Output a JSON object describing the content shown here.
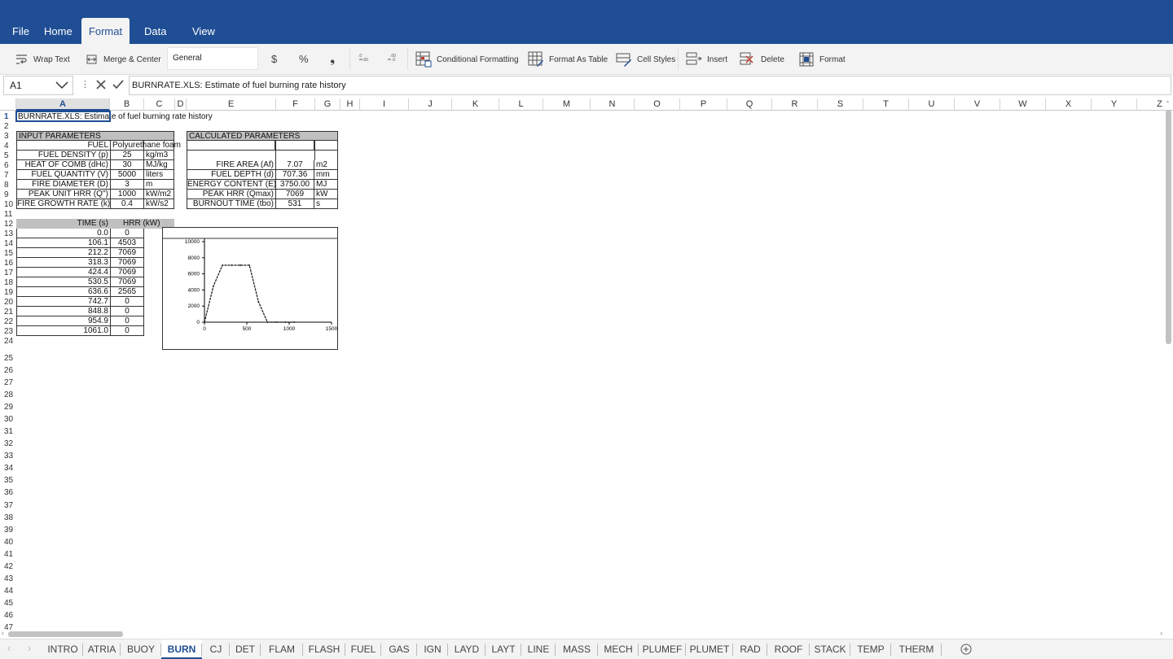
{
  "ribbon": {
    "tabs": [
      {
        "label": "File"
      },
      {
        "label": "Home"
      },
      {
        "label": "Format"
      },
      {
        "label": "Data"
      },
      {
        "label": "View"
      }
    ]
  },
  "toolbar": {
    "wrap_text": "Wrap Text",
    "merge_center": "Merge & Center",
    "number_format": "General",
    "currency": "$",
    "percent": "%",
    "comma": "❟",
    "conditional_formatting": "Conditional Formatting",
    "format_as_table": "Format As Table",
    "cell_styles": "Cell Styles",
    "insert": "Insert",
    "delete": "Delete",
    "format": "Format"
  },
  "formula_bar": {
    "name_box": "A1",
    "formula": "BURNRATE.XLS: Estimate of fuel burning rate history"
  },
  "columns": [
    "A",
    "B",
    "C",
    "D",
    "E",
    "F",
    "G",
    "H",
    "I",
    "J",
    "K",
    "L",
    "M",
    "N",
    "O",
    "P",
    "Q",
    "R",
    "S",
    "T",
    "U",
    "V",
    "W",
    "X",
    "Y",
    "Z"
  ],
  "cells": {
    "title": "BURNRATE.XLS: Estimate of fuel burning rate history",
    "input_header": "INPUT PARAMETERS",
    "calc_header": "CALCULATED PARAMETERS",
    "inputs": [
      {
        "label": "FUEL",
        "value": "Polyurethane foam",
        "unit": ""
      },
      {
        "label": "FUEL DENSITY (p)",
        "value": "25",
        "unit": "kg/m3"
      },
      {
        "label": "HEAT OF COMB (dHc)",
        "value": "30",
        "unit": "MJ/kg"
      },
      {
        "label": "FUEL QUANTITY (V)",
        "value": "5000",
        "unit": "liters"
      },
      {
        "label": "FIRE DIAMETER (D)",
        "value": "3",
        "unit": "m"
      },
      {
        "label": "PEAK UNIT HRR (Q'')",
        "value": "1000",
        "unit": "kW/m2"
      },
      {
        "label": "FIRE GROWTH RATE (k)",
        "value": "0.4",
        "unit": "kW/s2"
      }
    ],
    "calcs": [
      {
        "label": "FIRE AREA (Af)",
        "value": "7.07",
        "unit": "m2"
      },
      {
        "label": "FUEL DEPTH (d)",
        "value": "707.36",
        "unit": "mm"
      },
      {
        "label": "ENERGY CONTENT (E)",
        "value": "3750.00",
        "unit": "MJ"
      },
      {
        "label": "PEAK HRR (Qmax)",
        "value": "7069",
        "unit": "kW"
      },
      {
        "label": "BURNOUT TIME (tbo)",
        "value": "531",
        "unit": "s"
      }
    ],
    "table_headers": {
      "time": "TIME (s)",
      "hrr": "HRR (kW)"
    },
    "table": [
      {
        "t": "0.0",
        "q": "0"
      },
      {
        "t": "106.1",
        "q": "4503"
      },
      {
        "t": "212.2",
        "q": "7069"
      },
      {
        "t": "318.3",
        "q": "7069"
      },
      {
        "t": "424.4",
        "q": "7069"
      },
      {
        "t": "530.5",
        "q": "7069"
      },
      {
        "t": "636.6",
        "q": "2565"
      },
      {
        "t": "742.7",
        "q": "0"
      },
      {
        "t": "848.8",
        "q": "0"
      },
      {
        "t": "954.9",
        "q": "0"
      },
      {
        "t": "1061.0",
        "q": "0"
      }
    ]
  },
  "chart_data": {
    "type": "line",
    "x": [
      0,
      106.1,
      212.2,
      318.3,
      424.4,
      530.5,
      636.6,
      742.7,
      848.8,
      954.9,
      1061.0
    ],
    "series": [
      {
        "values": [
          0,
          4503,
          7069,
          7069,
          7069,
          7069,
          2565,
          0,
          0,
          0,
          0
        ]
      }
    ],
    "xlim": [
      0,
      1500
    ],
    "ylim": [
      0,
      10000
    ],
    "xticks": [
      "0",
      "500",
      "1000",
      "1500"
    ],
    "yticks": [
      "0",
      "2000",
      "4000",
      "6000",
      "8000",
      "10000"
    ],
    "title": "",
    "xlabel": "",
    "ylabel": "",
    "grid": false
  },
  "sheets": [
    {
      "label": "INTRO"
    },
    {
      "label": "ATRIA"
    },
    {
      "label": "BUOY"
    },
    {
      "label": "BURN"
    },
    {
      "label": "CJ"
    },
    {
      "label": "DET"
    },
    {
      "label": "FLAM"
    },
    {
      "label": "FLASH"
    },
    {
      "label": "FUEL"
    },
    {
      "label": "GAS"
    },
    {
      "label": "IGN"
    },
    {
      "label": "LAYD"
    },
    {
      "label": "LAYT"
    },
    {
      "label": "LINE"
    },
    {
      "label": "MASS"
    },
    {
      "label": "MECH"
    },
    {
      "label": "PLUMEF"
    },
    {
      "label": "PLUMET"
    },
    {
      "label": "RAD"
    },
    {
      "label": "ROOF"
    },
    {
      "label": "STACK"
    },
    {
      "label": "TEMP"
    },
    {
      "label": "THERM"
    }
  ],
  "active_sheet": "BURN",
  "add_sheet_icon": "plus-circle-icon"
}
